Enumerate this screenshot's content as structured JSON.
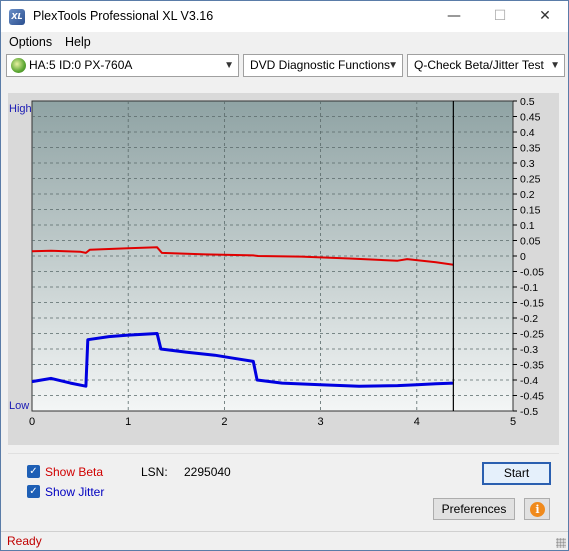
{
  "window": {
    "title": "PlexTools Professional XL V3.16",
    "app_icon_text": "XL",
    "controls": {
      "minimize": "—",
      "maximize": "☐",
      "close": "✕"
    }
  },
  "menu": {
    "items": [
      {
        "label": "Options"
      },
      {
        "label": "Help"
      }
    ]
  },
  "toolbar": {
    "drive": "HA:5 ID:0  PX-760A",
    "function": "DVD Diagnostic Functions",
    "test": "Q-Check Beta/Jitter Test"
  },
  "chart_data": {
    "type": "line",
    "y_left_labels": {
      "top": "High",
      "bottom": "Low"
    },
    "xlim": [
      0,
      5
    ],
    "x_ticks": [
      "0",
      "1",
      "2",
      "3",
      "4",
      "5"
    ],
    "right_axis_ylim": [
      -0.5,
      0.5
    ],
    "right_axis_ticks": [
      "0.5",
      "0.45",
      "0.4",
      "0.35",
      "0.3",
      "0.25",
      "0.2",
      "0.15",
      "0.1",
      "0.05",
      "0",
      "-0.05",
      "-0.1",
      "-0.15",
      "-0.2",
      "-0.25",
      "-0.3",
      "-0.35",
      "-0.4",
      "-0.45",
      "-0.5"
    ],
    "end_marker_x": 4.38,
    "grid": true,
    "series": [
      {
        "color": "#e00000",
        "x": [
          0.0,
          0.2,
          0.5,
          0.56,
          0.6,
          1.0,
          1.3,
          1.35,
          1.8,
          2.3,
          2.35,
          2.8,
          3.3,
          3.8,
          3.9,
          4.2,
          4.38
        ],
        "y": [
          0.015,
          0.017,
          0.014,
          0.01,
          0.02,
          0.025,
          0.028,
          0.01,
          0.005,
          0.002,
          0.0,
          -0.002,
          -0.008,
          -0.015,
          -0.01,
          -0.02,
          -0.028
        ]
      },
      {
        "color": "#0000e0",
        "x": [
          0.0,
          0.2,
          0.4,
          0.56,
          0.58,
          0.8,
          1.0,
          1.3,
          1.34,
          1.6,
          1.9,
          2.1,
          2.3,
          2.34,
          2.6,
          3.0,
          3.4,
          3.8,
          4.0,
          4.2,
          4.38
        ],
        "y": [
          -0.405,
          -0.395,
          -0.41,
          -0.42,
          -0.27,
          -0.26,
          -0.255,
          -0.25,
          -0.3,
          -0.31,
          -0.32,
          -0.33,
          -0.34,
          -0.4,
          -0.41,
          -0.415,
          -0.42,
          -0.418,
          -0.415,
          -0.412,
          -0.41
        ]
      }
    ]
  },
  "bottom": {
    "show_beta": {
      "label": "Show Beta",
      "checked": true,
      "color": "#d00000"
    },
    "show_jitter": {
      "label": "Show Jitter",
      "checked": true,
      "color": "#0000c0"
    },
    "lsn_label": "LSN:",
    "lsn_value": "2295040",
    "start_label": "Start",
    "preferences_label": "Preferences",
    "info_label": "i"
  },
  "status": {
    "text": "Ready"
  }
}
